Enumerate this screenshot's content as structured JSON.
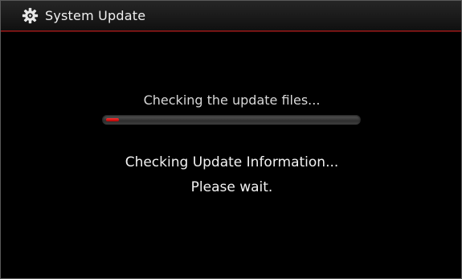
{
  "header": {
    "icon": "gear-icon",
    "title": "System Update"
  },
  "status": {
    "text": "Checking the update files...",
    "progress": 0.05
  },
  "message": {
    "line1": "Checking Update Information...",
    "line2": "Please wait."
  },
  "colors": {
    "background": "#000000",
    "accent": "#b01c1c",
    "progress_fill": "#e01010"
  }
}
